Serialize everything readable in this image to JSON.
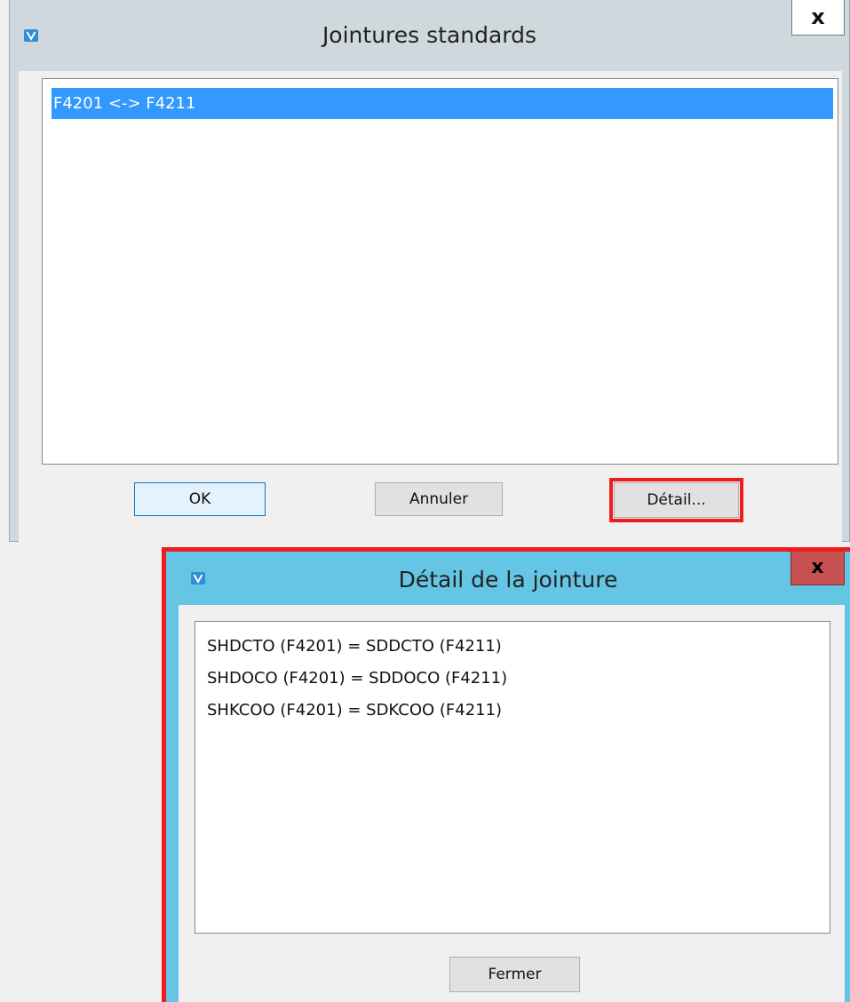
{
  "joins_window": {
    "title": "Jointures standards",
    "close_label": "x",
    "items": [
      {
        "label": "F4201 <-> F4211",
        "selected": true
      }
    ],
    "buttons": {
      "ok": "OK",
      "cancel": "Annuler",
      "detail": "Détail..."
    }
  },
  "detail_window": {
    "title": "Détail de la jointure",
    "close_label": "x",
    "rows": [
      "SHDCTO (F4201) = SDDCTO (F4211)",
      "SHDOCO (F4201) = SDDOCO (F4211)",
      "SHKCOO (F4201) = SDKCOO (F4211)"
    ],
    "close_button": "Fermer"
  },
  "colors": {
    "selection": "#3399ff",
    "highlight": "#ee1c1c",
    "active_title_bar": "#65c5e5",
    "close_button_active": "#c75050"
  },
  "icons": {
    "app": "app-logo-icon"
  }
}
